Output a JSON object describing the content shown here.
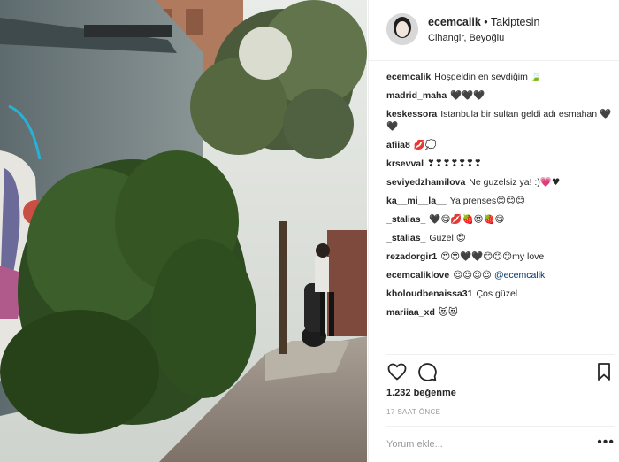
{
  "photo": {
    "alt": "street photo with trees, wall mural and scooter"
  },
  "header": {
    "username": "ecemcalik",
    "separator": " • ",
    "follow": "Takiptesin",
    "location": "Cihangir, Beyoğlu"
  },
  "comments": [
    {
      "user": "ecemcalik",
      "text": "Hoşgeldin en sevdiğim",
      "emoji": "🍃"
    },
    {
      "user": "madrid_maha",
      "text": "",
      "emoji": "🖤🖤🖤"
    },
    {
      "user": "keskessora",
      "text": "Istanbula bir sultan geldi adı esmahan",
      "emoji": "🖤🖤"
    },
    {
      "user": "afiia8",
      "text": "",
      "emoji": "💋💭"
    },
    {
      "user": "krsevval",
      "text": "",
      "emoji": "❣❣❣❣❣❣❣"
    },
    {
      "user": "seviyedzhamilova",
      "text": "Ne guzelsiz ya! :)",
      "emoji": "💗♥"
    },
    {
      "user": "ka__mi__la__",
      "text": "Ya prenses",
      "emoji": "😊😊😊"
    },
    {
      "user": "_stalias_",
      "text": "",
      "emoji": "🖤😋💋🍓😍🍓😋"
    },
    {
      "user": "_stalias_",
      "text": "Güzel",
      "emoji": "😍"
    },
    {
      "user": "rezadorgir1",
      "text": "",
      "emoji": "😍😍🖤🖤😊😊😊",
      "tail": "my love"
    },
    {
      "user": "ecemcaliklove",
      "text": "",
      "emoji": "😍😍😍😍",
      "mention": "@ecemcalik"
    },
    {
      "user": "kholoudbenaissa31",
      "text": "Ços güzel",
      "emoji": ""
    },
    {
      "user": "mariiaa_xd",
      "text": "",
      "emoji": "😻😻"
    }
  ],
  "actions": {
    "like_icon": "heart-icon",
    "comment_icon": "comment-icon",
    "save_icon": "bookmark-icon"
  },
  "likes": "1.232 beğenme",
  "time": "17 SAAT ÖNCE",
  "add_comment": {
    "placeholder": "Yorum ekle...",
    "more": "•••"
  },
  "colors": {
    "text": "#262626",
    "muted": "#999999",
    "border": "#efefef",
    "link": "#003569"
  }
}
